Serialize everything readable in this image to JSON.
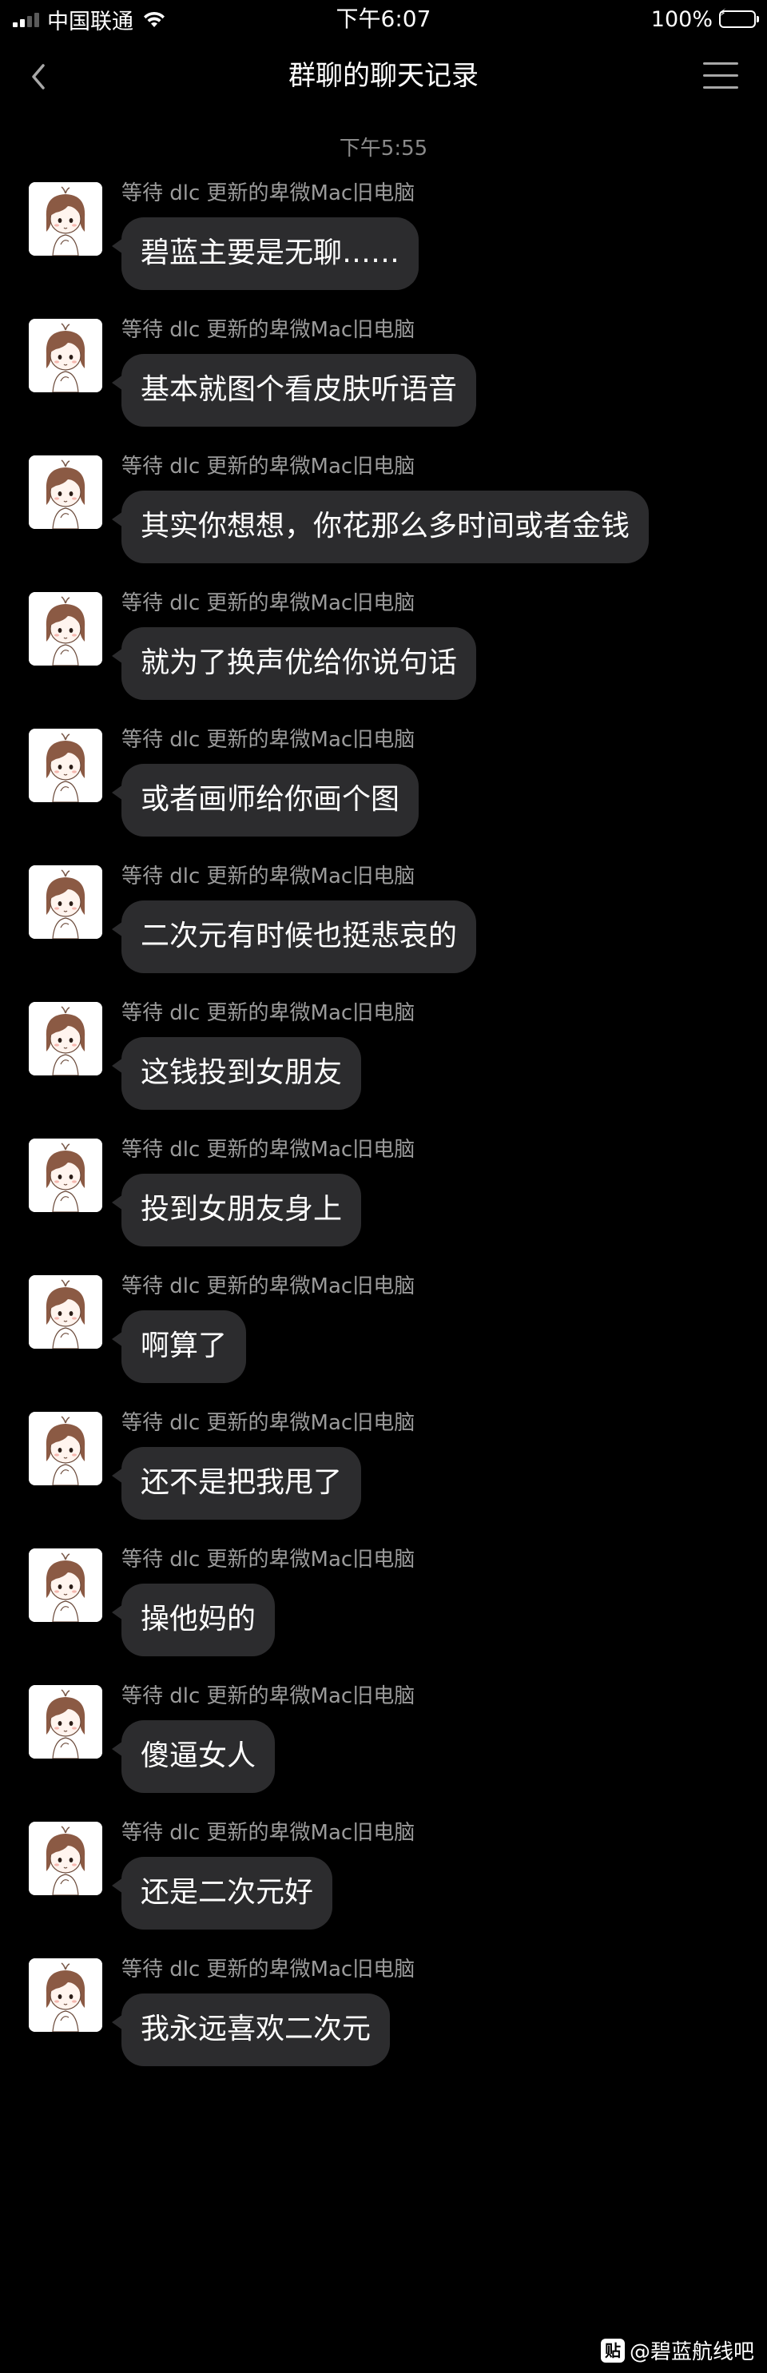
{
  "status_bar": {
    "carrier": "中国联通",
    "time": "下午6:07",
    "battery_text": "100%",
    "battery_level": 1.0,
    "colors": {
      "battery": "#4cd964"
    }
  },
  "nav": {
    "title": "群聊的聊天记录",
    "back_icon": "chevron-left-icon",
    "menu_icon": "hamburger-menu-icon"
  },
  "chat": {
    "time_divider": "下午5:55",
    "messages": [
      {
        "sender": "等待 dlc 更新的卑微Mac旧电脑",
        "text": "碧蓝主要是无聊……"
      },
      {
        "sender": "等待 dlc 更新的卑微Mac旧电脑",
        "text": "基本就图个看皮肤听语音"
      },
      {
        "sender": "等待 dlc 更新的卑微Mac旧电脑",
        "text": "其实你想想，你花那么多时间或者金钱"
      },
      {
        "sender": "等待 dlc 更新的卑微Mac旧电脑",
        "text": "就为了换声优给你说句话"
      },
      {
        "sender": "等待 dlc 更新的卑微Mac旧电脑",
        "text": "或者画师给你画个图"
      },
      {
        "sender": "等待 dlc 更新的卑微Mac旧电脑",
        "text": "二次元有时候也挺悲哀的"
      },
      {
        "sender": "等待 dlc 更新的卑微Mac旧电脑",
        "text": "这钱投到女朋友"
      },
      {
        "sender": "等待 dlc 更新的卑微Mac旧电脑",
        "text": "投到女朋友身上"
      },
      {
        "sender": "等待 dlc 更新的卑微Mac旧电脑",
        "text": "啊算了"
      },
      {
        "sender": "等待 dlc 更新的卑微Mac旧电脑",
        "text": "还不是把我甩了"
      },
      {
        "sender": "等待 dlc 更新的卑微Mac旧电脑",
        "text": "操他妈的"
      },
      {
        "sender": "等待 dlc 更新的卑微Mac旧电脑",
        "text": "傻逼女人"
      },
      {
        "sender": "等待 dlc 更新的卑微Mac旧电脑",
        "text": "还是二次元好"
      },
      {
        "sender": "等待 dlc 更新的卑微Mac旧电脑",
        "text": "我永远喜欢二次元"
      }
    ]
  },
  "watermark": {
    "logo": "贴",
    "text": "@碧蓝航线吧"
  },
  "colors": {
    "background": "#000000",
    "bubble": "#2c2c2e",
    "sender_text": "#9b9b9b"
  }
}
